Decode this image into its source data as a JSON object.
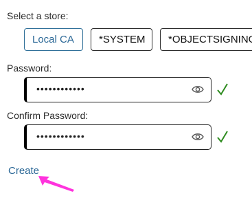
{
  "store_selector": {
    "label": "Select a store:",
    "options": [
      {
        "label": "Local CA",
        "selected": true
      },
      {
        "label": "*SYSTEM",
        "selected": false
      },
      {
        "label": "*OBJECTSIGNING",
        "selected": false
      }
    ]
  },
  "password": {
    "label": "Password:",
    "masked_value": "••••••••••••",
    "valid": true
  },
  "confirm_password": {
    "label": "Confirm Password:",
    "masked_value": "••••••••••••",
    "valid": true
  },
  "actions": {
    "create_label": "Create"
  },
  "colors": {
    "accent": "#2a6796",
    "valid_check": "#2e8b1f",
    "pointer": "#ff33dd"
  },
  "icons": {
    "reveal": "eye-icon",
    "valid": "checkmark-icon",
    "pointer": "pointer-arrow-icon"
  }
}
